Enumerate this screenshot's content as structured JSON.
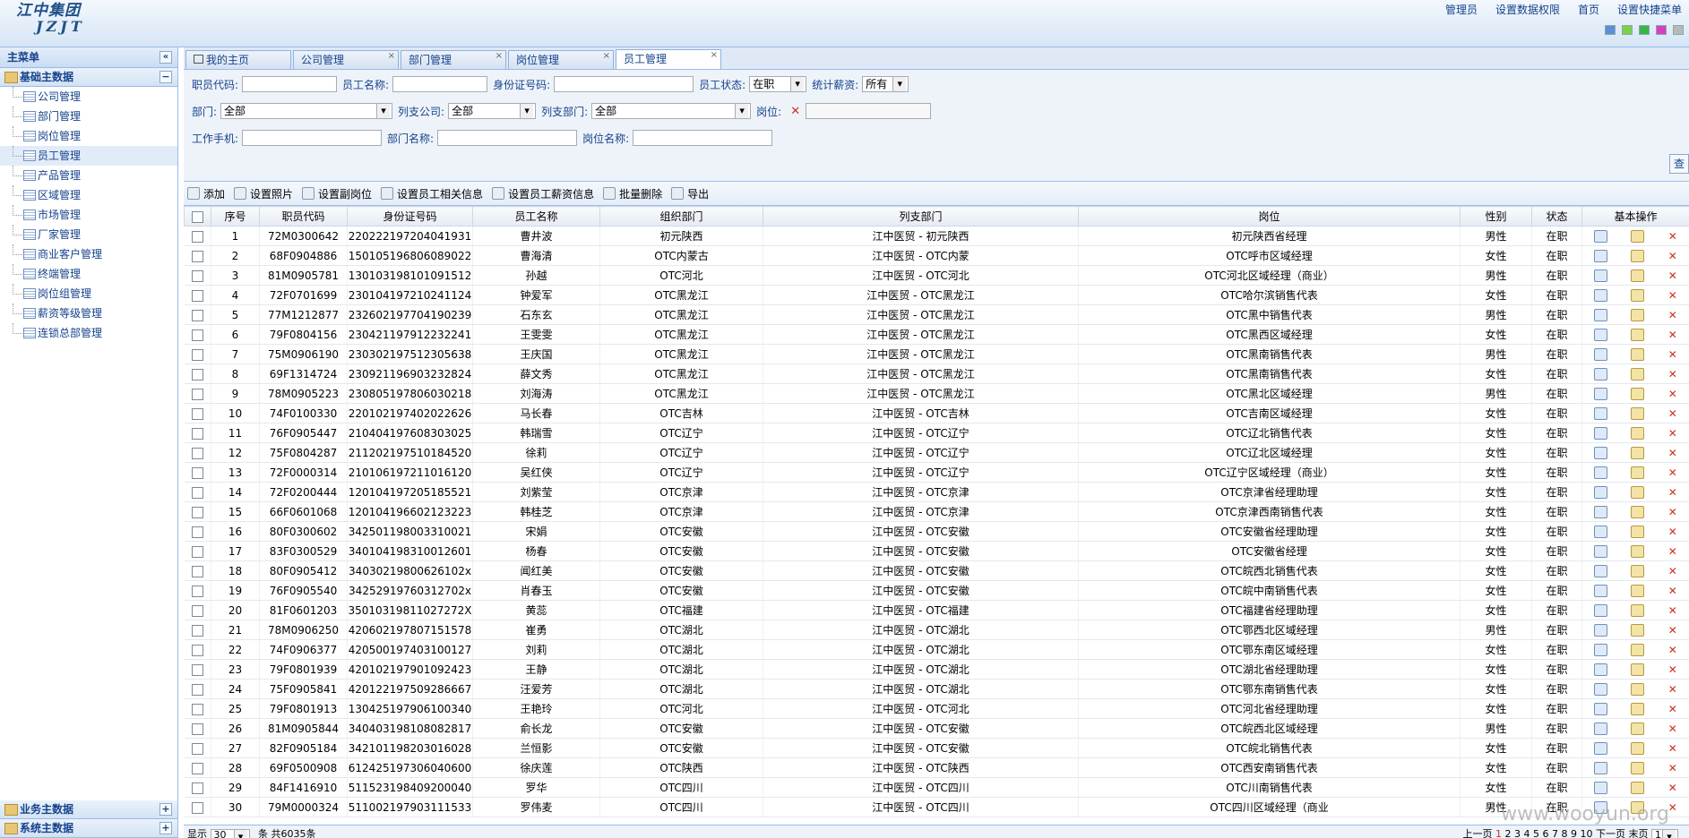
{
  "logo": {
    "line1": "江中集团",
    "line2": "JZJT"
  },
  "toplinks": [
    "管理员",
    "设置数据权限",
    "首页",
    "设置快捷菜单"
  ],
  "swatches": [
    "#5b8fd6",
    "#7fcf4e",
    "#3bb34a",
    "#d63fc1",
    "#b8b8b8"
  ],
  "sidebar": {
    "title": "主菜单",
    "group": "基础主数据",
    "items": [
      "公司管理",
      "部门管理",
      "岗位管理",
      "员工管理",
      "产品管理",
      "区域管理",
      "市场管理",
      "厂家管理",
      "商业客户管理",
      "终端管理",
      "岗位组管理",
      "薪资等级管理",
      "连锁总部管理"
    ],
    "bottom_groups": [
      "业务主数据",
      "系统主数据"
    ]
  },
  "tabs": [
    "我的主页",
    "公司管理",
    "部门管理",
    "岗位管理",
    "员工管理"
  ],
  "form": {
    "code_label": "职员代码:",
    "name_label": "员工名称:",
    "id_label": "身份证号码:",
    "status_label": "员工状态:",
    "status_value": "在职",
    "salary_label": "统计薪资:",
    "salary_value": "所有",
    "dept_label": "部门:",
    "dept_value": "全部",
    "pay_company_label": "列支公司:",
    "pay_company_value": "全部",
    "pay_dept_label": "列支部门:",
    "pay_dept_value": "全部",
    "post_label": "岗位:",
    "phone_label": "工作手机:",
    "dept_name_label": "部门名称:",
    "post_name_label": "岗位名称:",
    "query_label": "查"
  },
  "toolbar": [
    "添加",
    "设置照片",
    "设置副岗位",
    "设置员工相关信息",
    "设置员工薪资信息",
    "批量删除",
    "导出"
  ],
  "columns": [
    "序号",
    "职员代码",
    "身份证号码",
    "员工名称",
    "组织部门",
    "列支部门",
    "岗位",
    "性别",
    "状态",
    "基本操作"
  ],
  "rows": [
    [
      "1",
      "72M0300642",
      "220222197204041931",
      "曹井波",
      "初元陕西",
      "江中医贸 - 初元陕西",
      "初元陕西省经理",
      "男性",
      "在职"
    ],
    [
      "2",
      "68F0904886",
      "150105196806089022",
      "曹海清",
      "OTC内蒙古",
      "江中医贸 - OTC内蒙",
      "OTC呼市区域经理",
      "女性",
      "在职"
    ],
    [
      "3",
      "81M0905781",
      "130103198101091512",
      "孙越",
      "OTC河北",
      "江中医贸 - OTC河北",
      "OTC河北区域经理（商业）",
      "男性",
      "在职"
    ],
    [
      "4",
      "72F0701699",
      "230104197210241124",
      "钟爱军",
      "OTC黑龙江",
      "江中医贸 - OTC黑龙江",
      "OTC哈尔滨销售代表",
      "女性",
      "在职"
    ],
    [
      "5",
      "77M1212877",
      "232602197704190239",
      "石东玄",
      "OTC黑龙江",
      "江中医贸 - OTC黑龙江",
      "OTC黑中销售代表",
      "男性",
      "在职"
    ],
    [
      "6",
      "79F0804156",
      "230421197912232241",
      "王雯雯",
      "OTC黑龙江",
      "江中医贸 - OTC黑龙江",
      "OTC黑西区域经理",
      "女性",
      "在职"
    ],
    [
      "7",
      "75M0906190",
      "230302197512305638",
      "王庆国",
      "OTC黑龙江",
      "江中医贸 - OTC黑龙江",
      "OTC黑南销售代表",
      "男性",
      "在职"
    ],
    [
      "8",
      "69F1314724",
      "230921196903232824",
      "薛文秀",
      "OTC黑龙江",
      "江中医贸 - OTC黑龙江",
      "OTC黑南销售代表",
      "女性",
      "在职"
    ],
    [
      "9",
      "78M0905223",
      "230805197806030218",
      "刘海涛",
      "OTC黑龙江",
      "江中医贸 - OTC黑龙江",
      "OTC黑北区域经理",
      "男性",
      "在职"
    ],
    [
      "10",
      "74F0100330",
      "220102197402022626",
      "马长春",
      "OTC吉林",
      "江中医贸 - OTC吉林",
      "OTC吉南区域经理",
      "女性",
      "在职"
    ],
    [
      "11",
      "76F0905447",
      "210404197608303025",
      "韩瑞雪",
      "OTC辽宁",
      "江中医贸 - OTC辽宁",
      "OTC辽北销售代表",
      "女性",
      "在职"
    ],
    [
      "12",
      "75F0804287",
      "211202197510184520",
      "徐莉",
      "OTC辽宁",
      "江中医贸 - OTC辽宁",
      "OTC辽北区域经理",
      "女性",
      "在职"
    ],
    [
      "13",
      "72F0000314",
      "210106197211016120",
      "吴红侠",
      "OTC辽宁",
      "江中医贸 - OTC辽宁",
      "OTC辽宁区域经理（商业）",
      "女性",
      "在职"
    ],
    [
      "14",
      "72F0200444",
      "120104197205185521",
      "刘紫莹",
      "OTC京津",
      "江中医贸 - OTC京津",
      "OTC京津省经理助理",
      "女性",
      "在职"
    ],
    [
      "15",
      "66F0601068",
      "120104196602123223",
      "韩桂芝",
      "OTC京津",
      "江中医贸 - OTC京津",
      "OTC京津西南销售代表",
      "女性",
      "在职"
    ],
    [
      "16",
      "80F0300602",
      "342501198003310021",
      "宋娟",
      "OTC安徽",
      "江中医贸 - OTC安徽",
      "OTC安徽省经理助理",
      "女性",
      "在职"
    ],
    [
      "17",
      "83F0300529",
      "340104198310012601",
      "杨春",
      "OTC安徽",
      "江中医贸 - OTC安徽",
      "OTC安徽省经理",
      "女性",
      "在职"
    ],
    [
      "18",
      "80F0905412",
      "34030219800626102x",
      "闻红美",
      "OTC安徽",
      "江中医贸 - OTC安徽",
      "OTC皖西北销售代表",
      "女性",
      "在职"
    ],
    [
      "19",
      "76F0905540",
      "34252919760312702x",
      "肖春玉",
      "OTC安徽",
      "江中医贸 - OTC安徽",
      "OTC皖中南销售代表",
      "女性",
      "在职"
    ],
    [
      "20",
      "81F0601203",
      "35010319811027272X",
      "黄蕊",
      "OTC福建",
      "江中医贸 - OTC福建",
      "OTC福建省经理助理",
      "女性",
      "在职"
    ],
    [
      "21",
      "78M0906250",
      "420602197807151578",
      "崔勇",
      "OTC湖北",
      "江中医贸 - OTC湖北",
      "OTC鄂西北区域经理",
      "男性",
      "在职"
    ],
    [
      "22",
      "74F0906377",
      "420500197403100127",
      "刘莉",
      "OTC湖北",
      "江中医贸 - OTC湖北",
      "OTC鄂东南区域经理",
      "女性",
      "在职"
    ],
    [
      "23",
      "79F0801939",
      "420102197901092423",
      "王静",
      "OTC湖北",
      "江中医贸 - OTC湖北",
      "OTC湖北省经理助理",
      "女性",
      "在职"
    ],
    [
      "24",
      "75F0905841",
      "420122197509286667",
      "汪爱芳",
      "OTC湖北",
      "江中医贸 - OTC湖北",
      "OTC鄂东南销售代表",
      "女性",
      "在职"
    ],
    [
      "25",
      "79F0801913",
      "130425197906100340",
      "王艳玲",
      "OTC河北",
      "江中医贸 - OTC河北",
      "OTC河北省经理助理",
      "女性",
      "在职"
    ],
    [
      "26",
      "81M0905844",
      "340403198108082817",
      "俞长龙",
      "OTC安徽",
      "江中医贸 - OTC安徽",
      "OTC皖西北区域经理",
      "男性",
      "在职"
    ],
    [
      "27",
      "82F0905184",
      "342101198203016028",
      "兰恒影",
      "OTC安徽",
      "江中医贸 - OTC安徽",
      "OTC皖北销售代表",
      "女性",
      "在职"
    ],
    [
      "28",
      "69F0500908",
      "612425197306040600",
      "徐庆莲",
      "OTC陕西",
      "江中医贸 - OTC陕西",
      "OTC西安南销售代表",
      "女性",
      "在职"
    ],
    [
      "29",
      "84F1416910",
      "511523198409200040",
      "罗华",
      "OTC四川",
      "江中医贸 - OTC四川",
      "OTC川南销售代表",
      "女性",
      "在职"
    ],
    [
      "30",
      "79M0000324",
      "511002197903111533",
      "罗伟麦",
      "OTC四川",
      "江中医贸 - OTC四川",
      "OTC四川区域经理（商业",
      "男性",
      "在职"
    ]
  ],
  "pager": {
    "show_label": "显示",
    "page_size": "30",
    "unit": "条",
    "total": "共6035条",
    "prev": "上一页",
    "pages": [
      "1",
      "2",
      "3",
      "4",
      "5",
      "6",
      "7",
      "8",
      "9",
      "10"
    ],
    "next": "下一页",
    "last": "末页",
    "current": "1"
  },
  "watermark": "www.wooyun.org"
}
